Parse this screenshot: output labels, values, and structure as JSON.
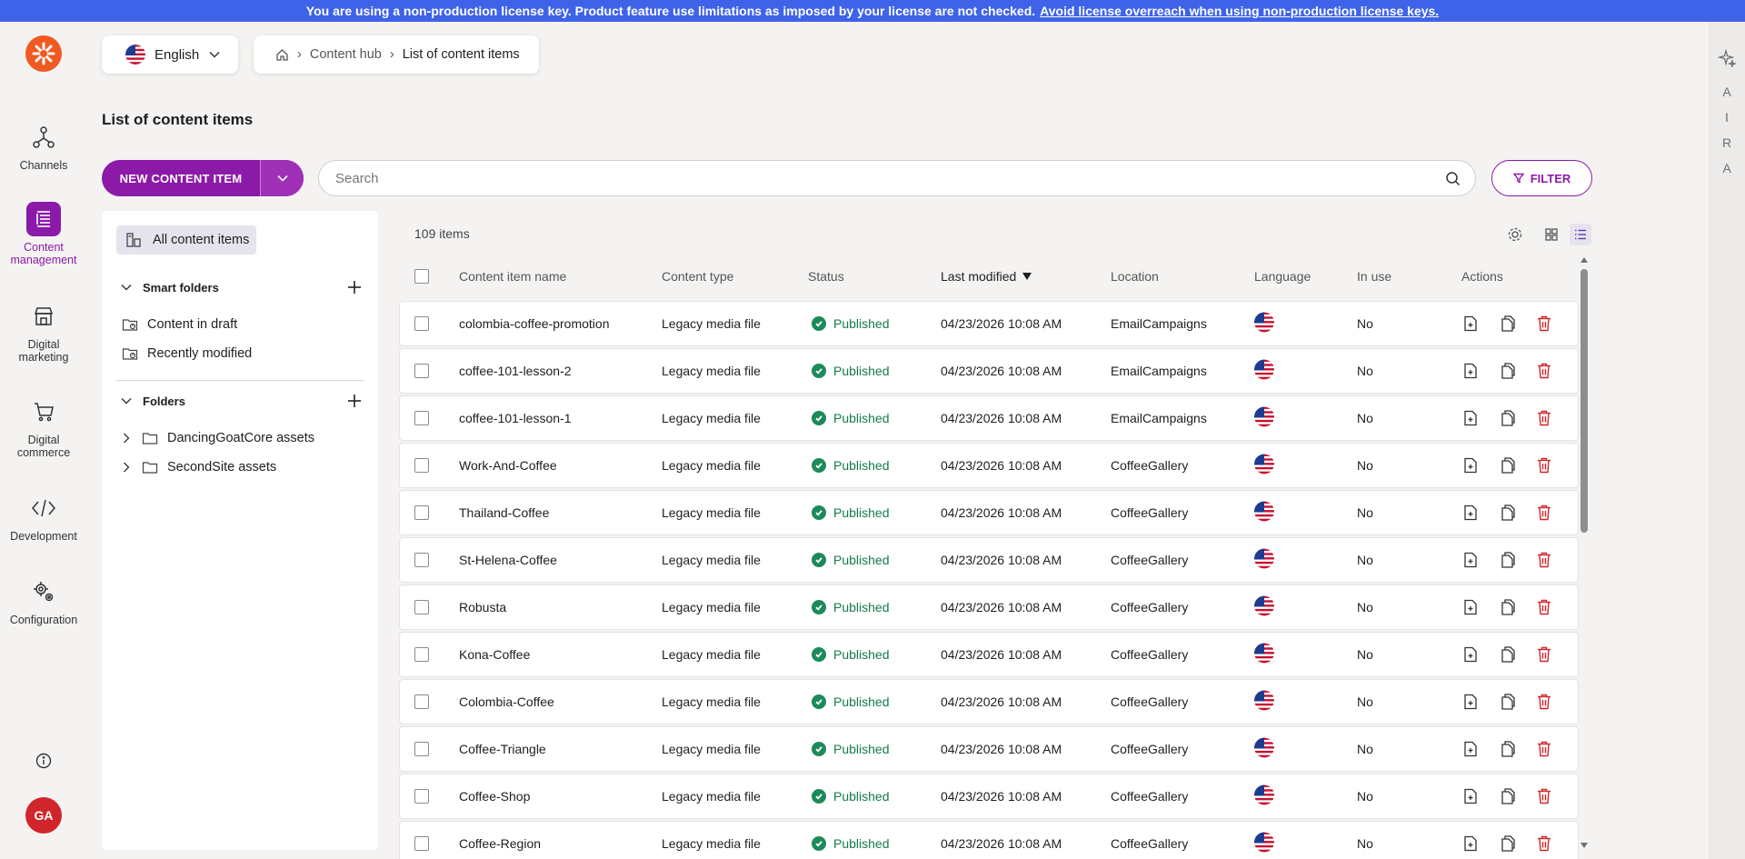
{
  "banner": {
    "text": "You are using a non-production license key. Product feature use limitations as imposed by your license are not checked.",
    "link": "Avoid license overreach when using non-production license keys."
  },
  "rail": {
    "channels": "Channels",
    "content_management": "Content management",
    "digital_marketing": "Digital marketing",
    "digital_commerce": "Digital commerce",
    "development": "Development",
    "configuration": "Configuration",
    "avatar_initials": "GA"
  },
  "aira": {
    "letters": [
      "A",
      "I",
      "R",
      "A"
    ]
  },
  "language": {
    "selected": "English"
  },
  "breadcrumb": {
    "items": [
      "Content hub",
      "List of content items"
    ]
  },
  "page_title": "List of content items",
  "toolbar": {
    "new_item_label": "NEW CONTENT ITEM",
    "search_placeholder": "Search",
    "filter_label": "FILTER"
  },
  "sidebar": {
    "all_items": "All content items",
    "smart_folders_title": "Smart folders",
    "smart_folders": [
      "Content in draft",
      "Recently modified"
    ],
    "folders_title": "Folders",
    "folders": [
      "DancingGoatCore assets",
      "SecondSite assets"
    ]
  },
  "list": {
    "count": "109 items",
    "columns": {
      "name": "Content item name",
      "type": "Content type",
      "status": "Status",
      "modified": "Last modified",
      "location": "Location",
      "language": "Language",
      "in_use": "In use",
      "actions": "Actions"
    },
    "rows": [
      {
        "name": "colombia-coffee-promotion",
        "type": "Legacy media file",
        "status": "Published",
        "modified": "04/23/2026 10:08 AM",
        "location": "EmailCampaigns",
        "in_use": "No"
      },
      {
        "name": "coffee-101-lesson-2",
        "type": "Legacy media file",
        "status": "Published",
        "modified": "04/23/2026 10:08 AM",
        "location": "EmailCampaigns",
        "in_use": "No"
      },
      {
        "name": "coffee-101-lesson-1",
        "type": "Legacy media file",
        "status": "Published",
        "modified": "04/23/2026 10:08 AM",
        "location": "EmailCampaigns",
        "in_use": "No"
      },
      {
        "name": "Work-And-Coffee",
        "type": "Legacy media file",
        "status": "Published",
        "modified": "04/23/2026 10:08 AM",
        "location": "CoffeeGallery",
        "in_use": "No"
      },
      {
        "name": "Thailand-Coffee",
        "type": "Legacy media file",
        "status": "Published",
        "modified": "04/23/2026 10:08 AM",
        "location": "CoffeeGallery",
        "in_use": "No"
      },
      {
        "name": "St-Helena-Coffee",
        "type": "Legacy media file",
        "status": "Published",
        "modified": "04/23/2026 10:08 AM",
        "location": "CoffeeGallery",
        "in_use": "No"
      },
      {
        "name": "Robusta",
        "type": "Legacy media file",
        "status": "Published",
        "modified": "04/23/2026 10:08 AM",
        "location": "CoffeeGallery",
        "in_use": "No"
      },
      {
        "name": "Kona-Coffee",
        "type": "Legacy media file",
        "status": "Published",
        "modified": "04/23/2026 10:08 AM",
        "location": "CoffeeGallery",
        "in_use": "No"
      },
      {
        "name": "Colombia-Coffee",
        "type": "Legacy media file",
        "status": "Published",
        "modified": "04/23/2026 10:08 AM",
        "location": "CoffeeGallery",
        "in_use": "No"
      },
      {
        "name": "Coffee-Triangle",
        "type": "Legacy media file",
        "status": "Published",
        "modified": "04/23/2026 10:08 AM",
        "location": "CoffeeGallery",
        "in_use": "No"
      },
      {
        "name": "Coffee-Shop",
        "type": "Legacy media file",
        "status": "Published",
        "modified": "04/23/2026 10:08 AM",
        "location": "CoffeeGallery",
        "in_use": "No"
      },
      {
        "name": "Coffee-Region",
        "type": "Legacy media file",
        "status": "Published",
        "modified": "04/23/2026 10:08 AM",
        "location": "CoffeeGallery",
        "in_use": "No"
      }
    ]
  },
  "colors": {
    "brand": "#8b1aa8",
    "banner": "#3f63e8",
    "published": "#1d8a5a",
    "delete": "#d0262b",
    "logo": "#f05a22"
  }
}
